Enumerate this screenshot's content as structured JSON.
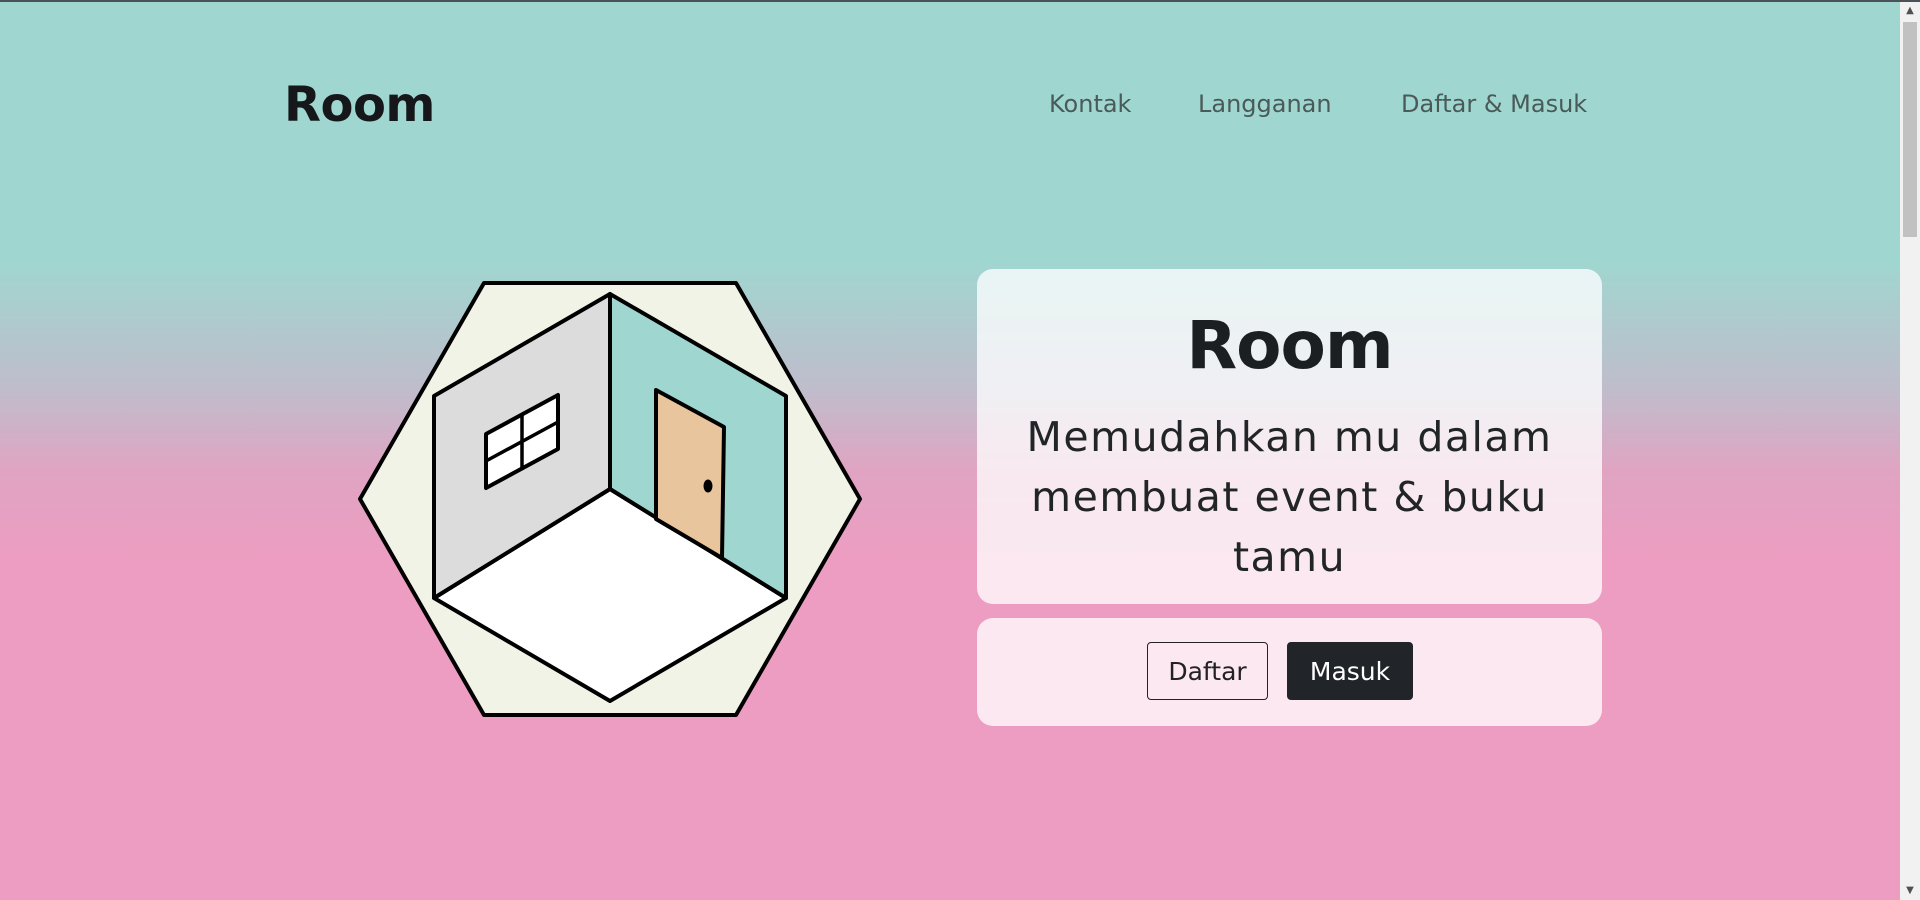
{
  "header": {
    "logo": "Room",
    "nav": [
      "Kontak",
      "Langganan",
      "Daftar & Masuk"
    ]
  },
  "hero": {
    "title": "Room",
    "subtitle": "Memudahkan mu dalam membuat event & buku tamu",
    "buttons": {
      "register": "Daftar",
      "login": "Masuk"
    }
  },
  "illustration": {
    "icon": "isometric-room-icon"
  },
  "colors": {
    "teal": "#9fd7d0",
    "pink": "#ed9dc1",
    "dark": "#212529",
    "hexagon_fill": "#f1f3e6",
    "door": "#e8c59c",
    "wall_left": "#dcdcdc"
  },
  "scrollbar": {
    "up_icon": "▲",
    "down_icon": "▼"
  }
}
